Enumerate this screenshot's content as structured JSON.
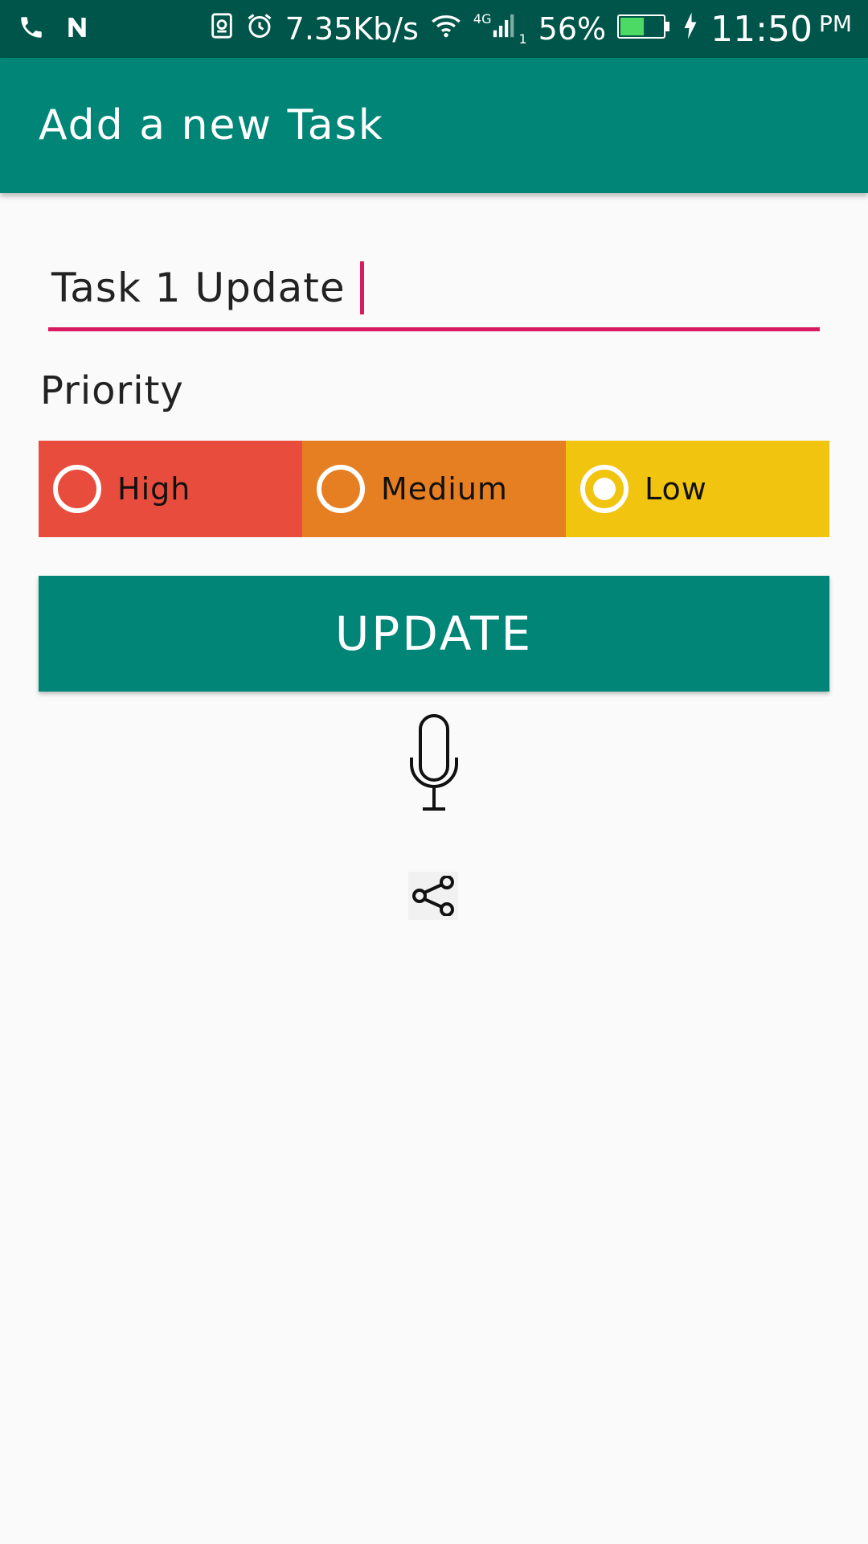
{
  "status_bar": {
    "net_speed": "7.35Kb/s",
    "network_type": "4G",
    "sim_slot": "1",
    "battery_percent": "56%",
    "battery_level": 0.56,
    "time": "11:50",
    "ampm": "PM",
    "icons": [
      "phone-icon",
      "n-notification-icon",
      "sim-card-icon",
      "alarm-icon",
      "wifi-icon",
      "signal-icon",
      "battery-icon",
      "charging-icon"
    ]
  },
  "app_bar": {
    "title": "Add a new Task"
  },
  "task_field": {
    "value": "Task 1 Update"
  },
  "priority": {
    "label": "Priority",
    "options": [
      {
        "label": "High",
        "color": "#e74c3c",
        "selected": false
      },
      {
        "label": "Medium",
        "color": "#e67e22",
        "selected": false
      },
      {
        "label": "Low",
        "color": "#f1c40f",
        "selected": true
      }
    ]
  },
  "update_button": {
    "label": "UPDATE"
  },
  "colors": {
    "primary": "#008577",
    "primary_dark": "#00554a",
    "accent": "#d81b60"
  },
  "action_icons": [
    "microphone-icon",
    "share-icon"
  ]
}
